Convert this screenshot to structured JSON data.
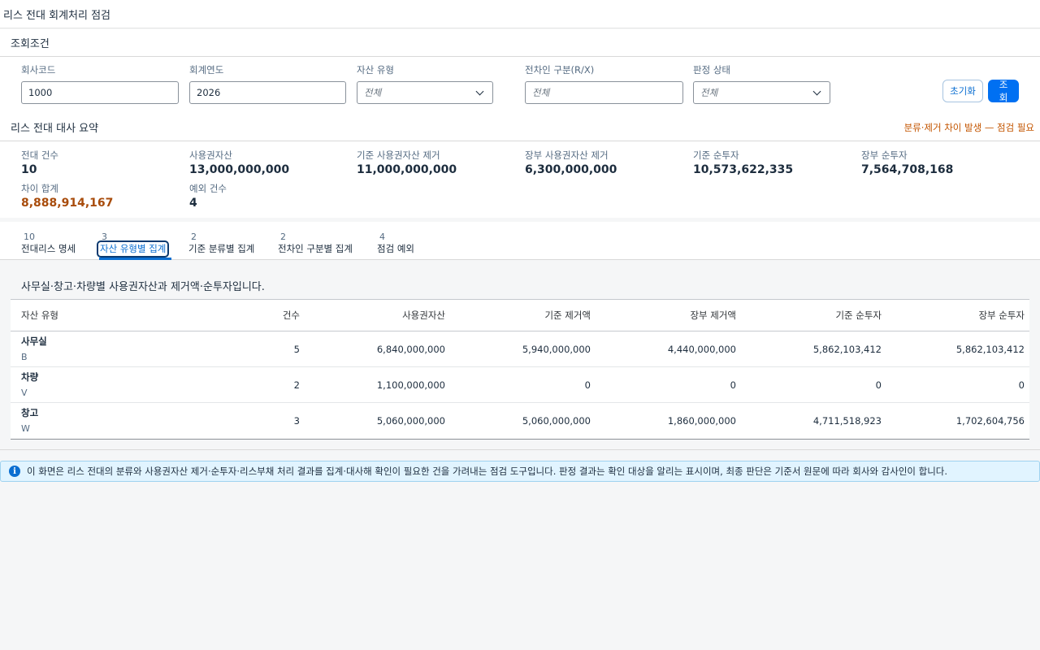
{
  "app": {
    "title": "리스 전대 회계처리 점검"
  },
  "filters": {
    "title": "조회조건",
    "company_code": {
      "label": "회사코드",
      "value": "1000"
    },
    "fiscal_year": {
      "label": "회계연도",
      "value": "2026"
    },
    "asset_type": {
      "label": "자산 유형",
      "value": "전체"
    },
    "lessee_type": {
      "label": "전차인 구분(R/X)",
      "placeholder": "전체"
    },
    "judgement_status": {
      "label": "판정 상태",
      "value": "전체"
    },
    "reset_label": "초기화",
    "search_label": "조회"
  },
  "summary": {
    "title": "리스 전대 대사 요약",
    "warning": "분류·제거 차이 발생 — 점검 필요",
    "kpis": {
      "sublease_count": {
        "label": "전대 건수",
        "value": "10"
      },
      "rou_asset": {
        "label": "사용권자산",
        "value": "13,000,000,000"
      },
      "std_rou_removal": {
        "label": "기준 사용권자산 제거",
        "value": "11,000,000,000"
      },
      "book_rou_removal": {
        "label": "장부 사용권자산 제거",
        "value": "6,300,000,000"
      },
      "std_net_investment": {
        "label": "기준 순투자",
        "value": "10,573,622,335"
      },
      "book_net_investment": {
        "label": "장부 순투자",
        "value": "7,564,708,168"
      },
      "diff_total": {
        "label": "차이 합계",
        "value": "8,888,914,167"
      },
      "exception_count": {
        "label": "예외 건수",
        "value": "4"
      }
    }
  },
  "tabs": [
    {
      "count": "10",
      "label": "전대리스 명세"
    },
    {
      "count": "3",
      "label": "자산 유형별 집계"
    },
    {
      "count": "2",
      "label": "기준 분류별 집계"
    },
    {
      "count": "2",
      "label": "전차인 구분별 집계"
    },
    {
      "count": "4",
      "label": "점검 예외"
    }
  ],
  "content": {
    "description": "사무실·창고·차량별 사용권자산과 제거액·순투자입니다.",
    "columns": {
      "type": "자산 유형",
      "count": "건수",
      "rou": "사용권자산",
      "std_removal": "기준 제거액",
      "book_removal": "장부 제거액",
      "std_net": "기준 순투자",
      "book_net": "장부 순투자"
    },
    "rows": [
      {
        "name": "사무실",
        "code": "B",
        "count": "5",
        "rou": "6,840,000,000",
        "std_removal": "5,940,000,000",
        "book_removal": "4,440,000,000",
        "std_net": "5,862,103,412",
        "book_net": "5,862,103,412"
      },
      {
        "name": "차량",
        "code": "V",
        "count": "2",
        "rou": "1,100,000,000",
        "std_removal": "0",
        "book_removal": "0",
        "std_net": "0",
        "book_net": "0"
      },
      {
        "name": "창고",
        "code": "W",
        "count": "3",
        "rou": "5,060,000,000",
        "std_removal": "5,060,000,000",
        "book_removal": "1,860,000,000",
        "std_net": "4,711,518,923",
        "book_net": "1,702,604,756"
      }
    ]
  },
  "info": {
    "icon": "info-icon",
    "text": "이 화면은 리스 전대의 분류와 사용권자산 제거·순투자·리스부채 처리 결과를 집계·대사해 확인이 필요한 건을 가려내는 점검 도구입니다. 판정 결과는 확인 대상을 알리는 표시이며, 최종 판단은 기준서 원문에 따라 회사와 감사인이 합니다."
  }
}
